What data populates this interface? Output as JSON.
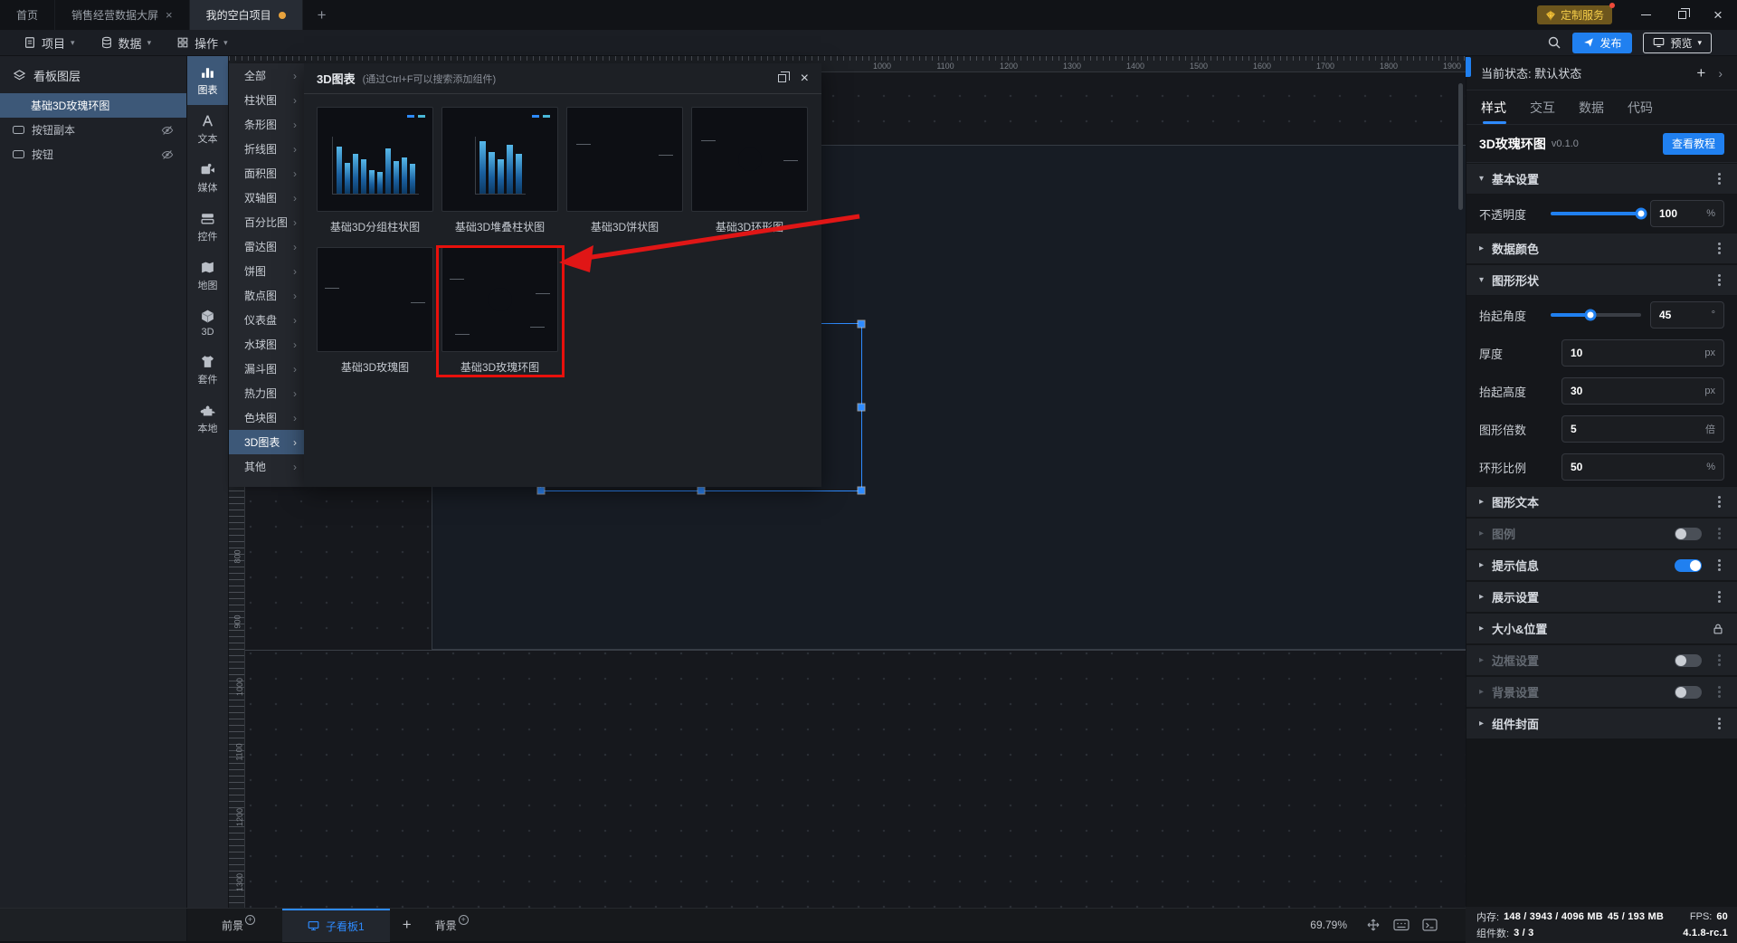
{
  "colors": {
    "accent": "#2483FF",
    "highlight_red": "#E8100C",
    "badge_gold": "#F7CF4A",
    "selected_row": "#3D5878"
  },
  "icons": {
    "caret_down": "▾",
    "chevron_right": "›",
    "expand_open": "▾",
    "expand_closed": "▸",
    "plus": "+",
    "close": "×",
    "unsaved_dot": "●",
    "state_arrow": "›"
  },
  "titlebar": {
    "tabs": [
      {
        "label": "首页"
      },
      {
        "label": "销售经营数据大屏"
      },
      {
        "label": "我的空白项目"
      }
    ],
    "service_badge": "定制服务"
  },
  "menubar": {
    "project": "项目",
    "data": "数据",
    "operation": "操作",
    "publish": "发布",
    "preview": "预览"
  },
  "layers": {
    "title": "看板图层",
    "items": [
      {
        "label": "基础3D玫瑰环图"
      },
      {
        "label": "按钮副本"
      },
      {
        "label": "按钮"
      }
    ]
  },
  "toolbox": {
    "items": [
      {
        "label": "图表"
      },
      {
        "label": "文本"
      },
      {
        "label": "媒体"
      },
      {
        "label": "控件"
      },
      {
        "label": "地图"
      },
      {
        "label": "3D"
      },
      {
        "label": "套件"
      },
      {
        "label": "本地"
      }
    ]
  },
  "categories": {
    "items": [
      {
        "label": "全部"
      },
      {
        "label": "柱状图"
      },
      {
        "label": "条形图"
      },
      {
        "label": "折线图"
      },
      {
        "label": "面积图"
      },
      {
        "label": "双轴图"
      },
      {
        "label": "百分比图"
      },
      {
        "label": "雷达图"
      },
      {
        "label": "饼图"
      },
      {
        "label": "散点图"
      },
      {
        "label": "仪表盘"
      },
      {
        "label": "水球图"
      },
      {
        "label": "漏斗图"
      },
      {
        "label": "热力图"
      },
      {
        "label": "色块图"
      },
      {
        "label": "3D图表"
      },
      {
        "label": "其他"
      }
    ]
  },
  "modal": {
    "title": "3D图表",
    "hint": "(通过Ctrl+F可以搜索添加组件)",
    "cards": [
      {
        "label": "基础3D分组柱状图"
      },
      {
        "label": "基础3D堆叠柱状图"
      },
      {
        "label": "基础3D饼状图"
      },
      {
        "label": "基础3D环形图"
      },
      {
        "label": "基础3D玫瑰图"
      },
      {
        "label": "基础3D玫瑰环图"
      }
    ]
  },
  "canvas": {
    "h_ruler": [
      "1000",
      "1100",
      "1200",
      "1300",
      "1400",
      "1500",
      "1600",
      "1700",
      "1800",
      "1900"
    ],
    "v_ruler": [
      "800",
      "900",
      "1000",
      "1100",
      "1200",
      "1300"
    ]
  },
  "inspector": {
    "state_label": "当前状态:",
    "state_value": "默认状态",
    "tabs": [
      {
        "label": "样式"
      },
      {
        "label": "交互"
      },
      {
        "label": "数据"
      },
      {
        "label": "代码"
      }
    ],
    "component": {
      "name": "3D玫瑰环图",
      "version": "v0.1.0",
      "tutorial_btn": "查看教程"
    },
    "sections": {
      "basic": "基本设置",
      "data_color": "数据颜色",
      "shape": "图形形状",
      "graph_text": "图形文本",
      "legend": "图例",
      "tooltip": "提示信息",
      "display": "展示设置",
      "size_pos": "大小&位置",
      "border": "边框设置",
      "background": "背景设置",
      "cover": "组件封面"
    },
    "fields": {
      "opacity": {
        "label": "不透明度",
        "value": "100",
        "unit": "%"
      },
      "lift_angle": {
        "label": "抬起角度",
        "value": "45",
        "unit": "°"
      },
      "thickness": {
        "label": "厚度",
        "value": "10",
        "unit": "px"
      },
      "lift_height": {
        "label": "抬起高度",
        "value": "30",
        "unit": "px"
      },
      "multiple": {
        "label": "图形倍数",
        "value": "5",
        "unit": "倍"
      },
      "ring_ratio": {
        "label": "环形比例",
        "value": "50",
        "unit": "%"
      }
    }
  },
  "bottombar": {
    "foreground": "前景",
    "board_tab": "子看板1",
    "background": "背景",
    "zoom": "69.79%",
    "memory_label": "内存:",
    "memory_value": "148 / 3943 / 4096 MB",
    "memory_value2": "45 / 193 MB",
    "fps_label": "FPS:",
    "fps_value": "60",
    "components_label": "组件数:",
    "components_value": "3 / 3",
    "version": "4.1.8-rc.1"
  }
}
